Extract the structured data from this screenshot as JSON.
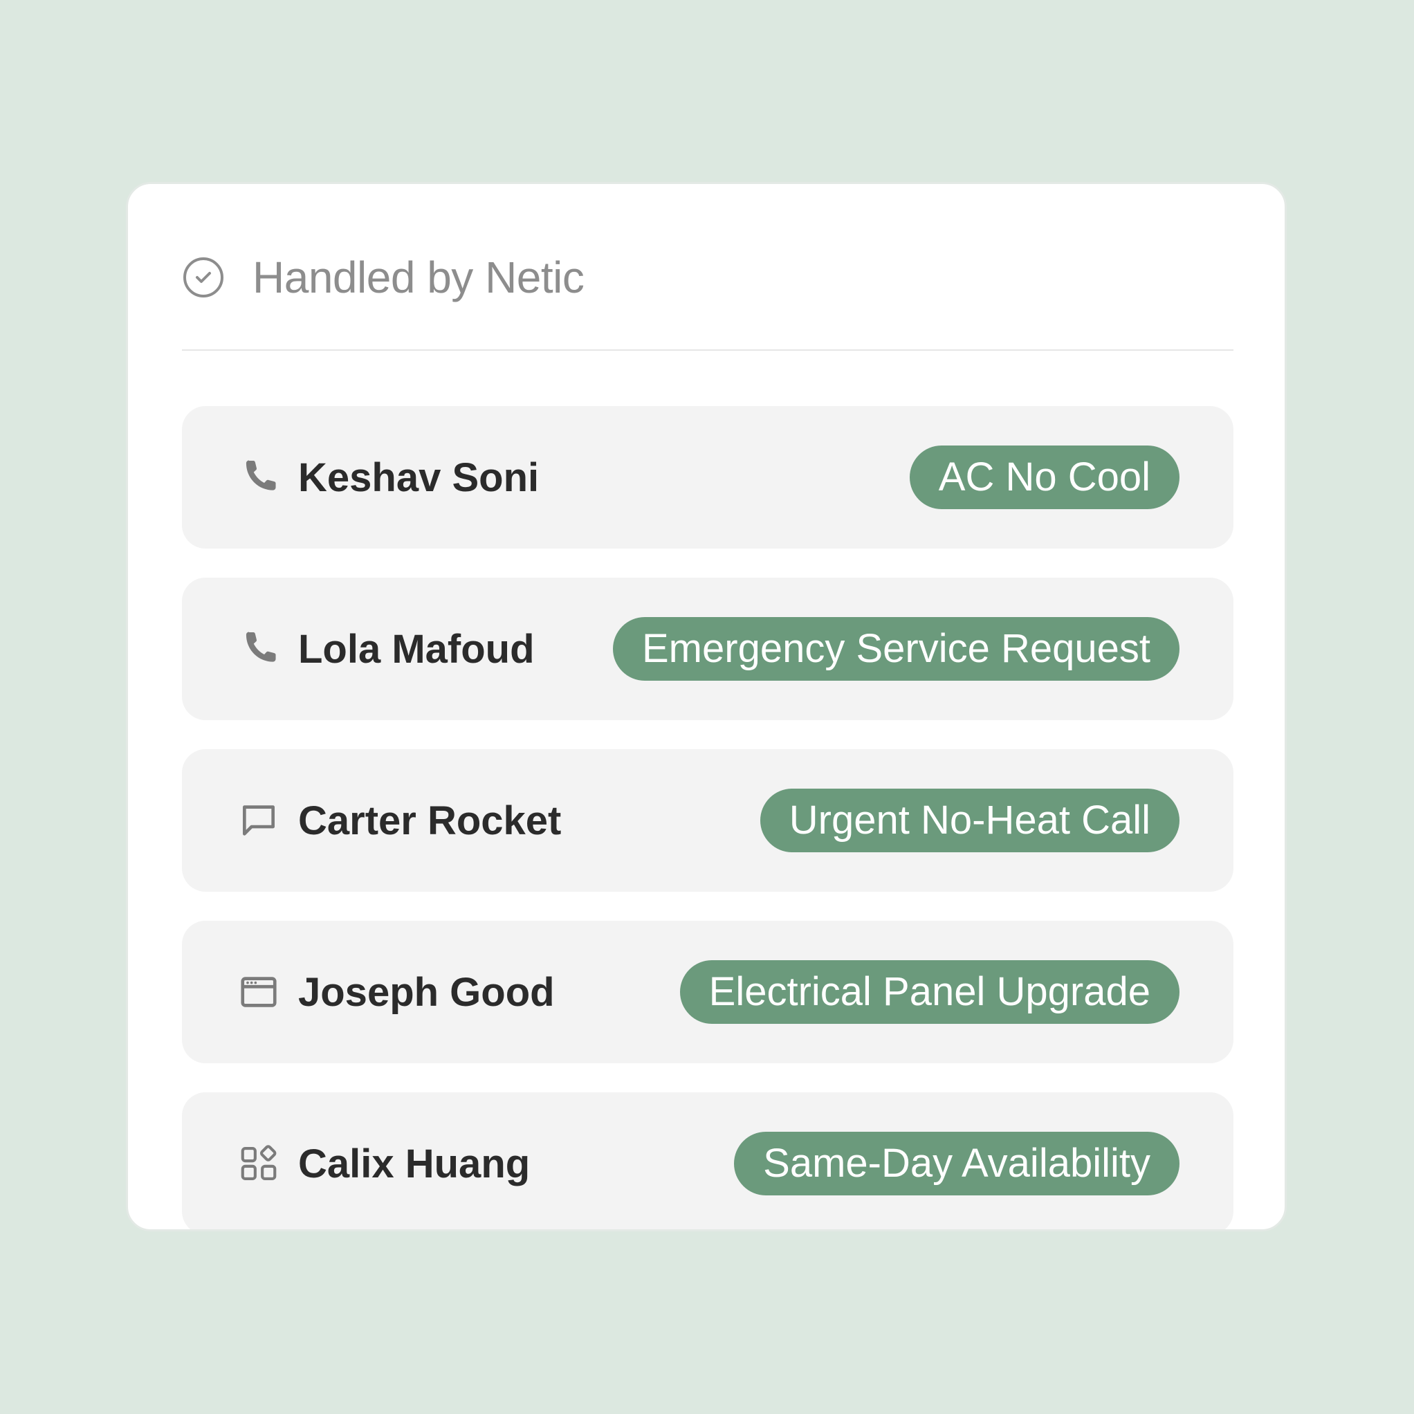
{
  "header": {
    "title": "Handled by Netic",
    "icon": "check-circle-icon"
  },
  "colors": {
    "background": "#dce8e0",
    "card": "#ffffff",
    "row": "#f3f3f3",
    "tag": "#6b9a7c",
    "icon": "#7b7b7b"
  },
  "rows": [
    {
      "name": "Keshav Soni",
      "tag": "AC No Cool",
      "icon": "phone-icon"
    },
    {
      "name": "Lola Mafoud",
      "tag": "Emergency Service Request",
      "icon": "phone-icon"
    },
    {
      "name": "Carter Rocket",
      "tag": "Urgent No-Heat Call",
      "icon": "chat-bubble-icon"
    },
    {
      "name": "Joseph Good",
      "tag": "Electrical Panel Upgrade",
      "icon": "browser-window-icon"
    },
    {
      "name": "Calix Huang",
      "tag": "Same-Day Availability",
      "icon": "apps-grid-icon"
    }
  ]
}
